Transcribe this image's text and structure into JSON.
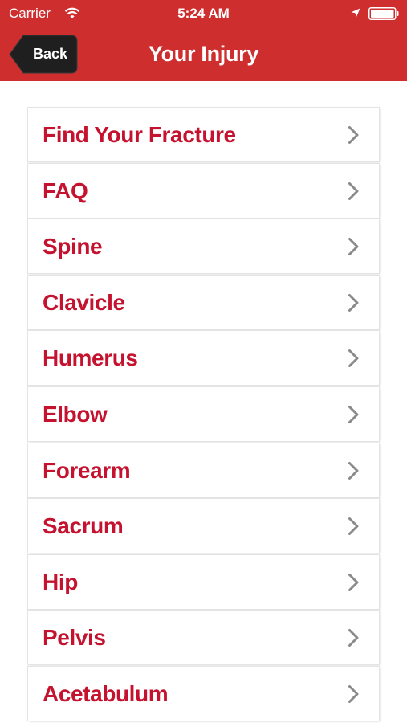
{
  "status_bar": {
    "carrier": "Carrier",
    "time": "5:24 AM",
    "icons": [
      "wifi-icon",
      "location-icon",
      "battery-icon"
    ]
  },
  "nav": {
    "back_label": "Back",
    "title": "Your Injury"
  },
  "menu": {
    "items": [
      {
        "label": "Find Your Fracture"
      },
      {
        "label": "FAQ"
      },
      {
        "label": "Spine"
      },
      {
        "label": "Clavicle"
      },
      {
        "label": "Humerus"
      },
      {
        "label": "Elbow"
      },
      {
        "label": "Forearm"
      },
      {
        "label": "Sacrum"
      },
      {
        "label": "Hip"
      },
      {
        "label": "Pelvis"
      },
      {
        "label": "Acetabulum"
      }
    ]
  },
  "colors": {
    "header_background": "#cf2e2f",
    "back_button": "#1f1f1f",
    "item_text": "#c4122f",
    "chevron": "#8a8a8a"
  }
}
